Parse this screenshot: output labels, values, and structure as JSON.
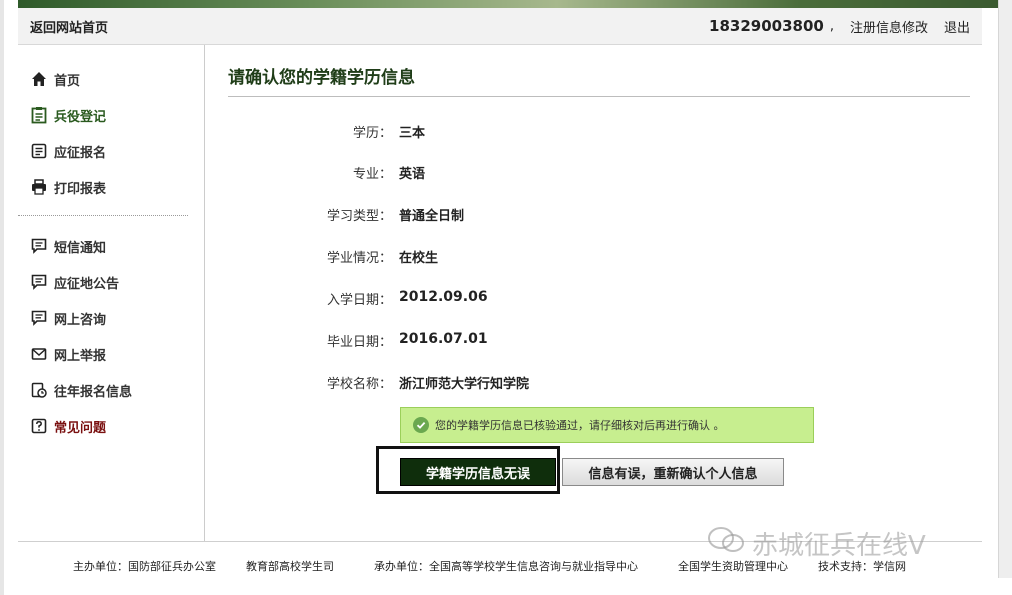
{
  "topbar": {
    "home_link": "返回网站首页",
    "phone": "18329003800",
    "separator": ",",
    "edit_link": "注册信息修改",
    "logout_link": "退出"
  },
  "sidebar": {
    "group1": [
      {
        "label": "首页",
        "icon": "home-icon"
      },
      {
        "label": "兵役登记",
        "icon": "clipboard-icon"
      },
      {
        "label": "应征报名",
        "icon": "document-icon"
      },
      {
        "label": "打印报表",
        "icon": "printer-icon"
      }
    ],
    "group2": [
      {
        "label": "短信通知",
        "icon": "message-icon"
      },
      {
        "label": "应征地公告",
        "icon": "announcement-icon"
      },
      {
        "label": "网上咨询",
        "icon": "chat-icon"
      },
      {
        "label": "网上举报",
        "icon": "mail-icon"
      },
      {
        "label": "往年报名信息",
        "icon": "history-icon"
      },
      {
        "label": "常见问题",
        "icon": "question-icon"
      }
    ]
  },
  "main": {
    "title": "请确认您的学籍学历信息",
    "fields": [
      {
        "label": "学历：",
        "value": "三本"
      },
      {
        "label": "专业：",
        "value": "英语"
      },
      {
        "label": "学习类型：",
        "value": "普通全日制"
      },
      {
        "label": "学业情况：",
        "value": "在校生"
      },
      {
        "label": "入学日期：",
        "value": "2012.09.06"
      },
      {
        "label": "毕业日期：",
        "value": "2016.07.01"
      },
      {
        "label": "学校名称：",
        "value": "浙江师范大学行知学院"
      }
    ],
    "notice": "您的学籍学历信息已核验通过，请仔细核对后再进行确认 。",
    "confirm_button": "学籍学历信息无误",
    "reconfirm_button": "信息有误，重新确认个人信息"
  },
  "footer": {
    "host": "主办单位：国防部征兵办公室",
    "host2": "教育部高校学生司",
    "organizer": "承办单位：全国高等学校学生信息咨询与就业指导中心",
    "organizer2": "全国学生资助管理中心",
    "tech": "技术支持：学信网"
  },
  "watermark": "赤城征兵在线V",
  "colors": {
    "accent_green": "#2a5a1f",
    "button_dark": "#0f2e0c",
    "notice_bg": "#c7ee8f",
    "faq_red": "#7a1010"
  }
}
